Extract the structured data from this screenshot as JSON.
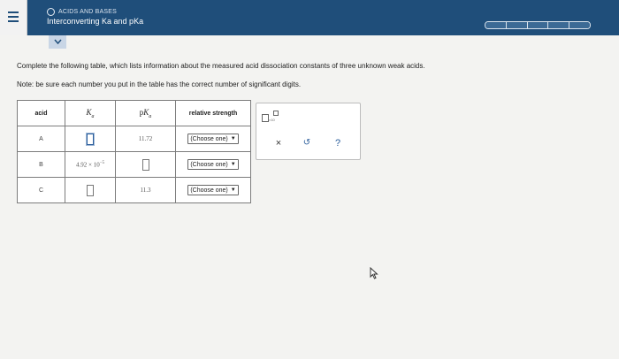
{
  "header": {
    "topic": "ACIDS AND BASES",
    "title": "Interconverting Ka and pKa",
    "progress_segments": 5,
    "colors": {
      "bar": "#1f4e7a",
      "accent": "#2a5d9b"
    }
  },
  "icons": {
    "menu": "hamburger-menu-icon",
    "collapse": "chevron-down-icon",
    "close": "close-icon",
    "undo": "undo-icon",
    "help": "help-icon",
    "scientific": "scientific-notation-icon",
    "cursor": "mouse-pointer-icon"
  },
  "question": {
    "instructions": "Complete the following table, which lists information about the measured acid dissociation constants of three unknown weak acids.",
    "note": "Note: be sure each number you put in the table has the correct number of significant digits."
  },
  "table": {
    "headers": {
      "acid": "acid",
      "ka_symbol": "K",
      "ka_subscript": "a",
      "pka_prefix": "p",
      "pka_symbol": "K",
      "pka_subscript": "a",
      "strength": "relative strength"
    },
    "rows": [
      {
        "acid": "A",
        "pka": "11.72",
        "strength": "(Choose one)"
      },
      {
        "acid": "B",
        "ka_mantissa": "4.92",
        "ka_times": "×",
        "ka_base": "10",
        "ka_exponent": "−5",
        "strength": "(Choose one)"
      },
      {
        "acid": "C",
        "pka": "11.3",
        "strength": "(Choose one)"
      }
    ]
  },
  "tools": {
    "sci_notation_label": "×10",
    "close": "×",
    "undo": "↺",
    "help": "?"
  }
}
